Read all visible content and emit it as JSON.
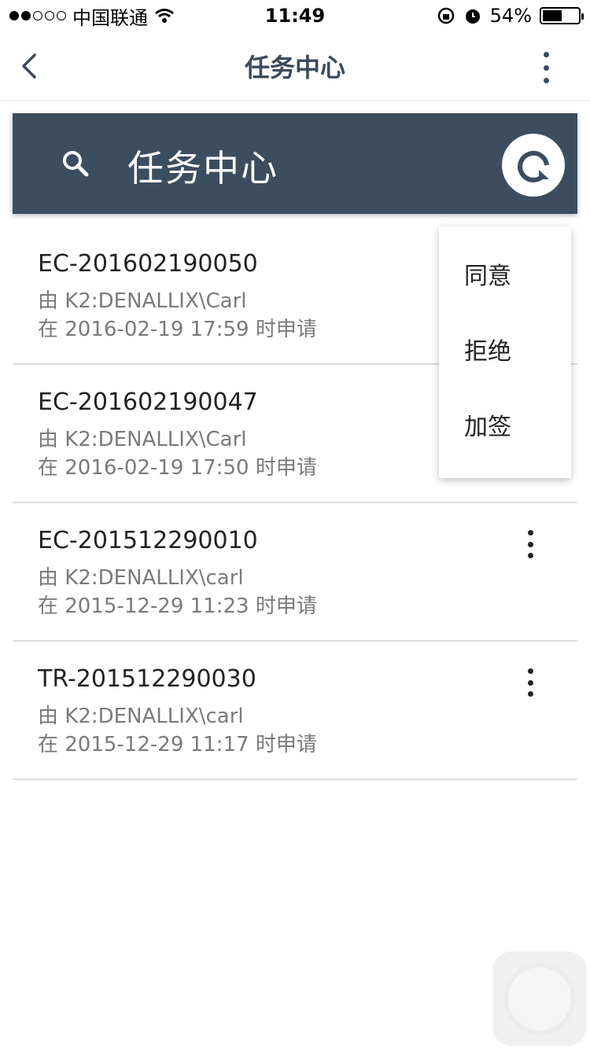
{
  "status_bar": {
    "carrier": "中国联通",
    "time": "11:49",
    "battery": "54%",
    "battery_level": 0.54
  },
  "nav": {
    "title": "任务中心"
  },
  "header": {
    "title": "任务中心",
    "accent_color": "#3c4d60"
  },
  "tasks": [
    {
      "id": "EC-201602190050",
      "by": "由 K2:DENALLIX\\Carl",
      "at": "在 2016-02-19 17:59 时申请"
    },
    {
      "id": "EC-201602190047",
      "by": "由 K2:DENALLIX\\Carl",
      "at": "在 2016-02-19 17:50 时申请"
    },
    {
      "id": "EC-201512290010",
      "by": "由 K2:DENALLIX\\carl",
      "at": "在 2015-12-29 11:23 时申请"
    },
    {
      "id": "TR-201512290030",
      "by": "由 K2:DENALLIX\\carl",
      "at": "在 2015-12-29 11:17 时申请"
    }
  ],
  "popup_menu": {
    "items": [
      "同意",
      "拒绝",
      "加签"
    ]
  }
}
